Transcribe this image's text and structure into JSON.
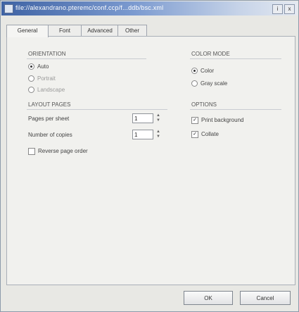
{
  "window": {
    "title": "file://alexandrano.pteremc/conf.ccp/f...ddb/bsc.xml",
    "min_label": "i",
    "close_label": "x"
  },
  "tabs": [
    {
      "label": "General"
    },
    {
      "label": "Font"
    },
    {
      "label": "Advanced"
    },
    {
      "label": "Other"
    }
  ],
  "groups": {
    "orientation": {
      "title": "ORIENTATION",
      "options": [
        {
          "label": "Auto",
          "selected": true
        },
        {
          "label": "Portrait",
          "selected": false
        },
        {
          "label": "Landscape",
          "selected": false
        }
      ]
    },
    "color_mode": {
      "title": "COLOR MODE",
      "options": [
        {
          "label": "Color",
          "selected": true
        },
        {
          "label": "Gray scale",
          "selected": false
        }
      ]
    },
    "layout": {
      "title": "LAYOUT PAGES",
      "pages_per_sheet_label": "Pages per sheet",
      "pages_per_sheet_value": "1",
      "copies_label": "Number of copies",
      "copies_value": "1",
      "reverse_label": "Reverse page order",
      "reverse_checked": false
    },
    "options": {
      "title": "OPTIONS",
      "items": [
        {
          "label": "Print background",
          "checked": true
        },
        {
          "label": "Collate",
          "checked": true
        }
      ]
    }
  },
  "buttons": {
    "ok_label": "OK",
    "cancel_label": "Cancel"
  }
}
